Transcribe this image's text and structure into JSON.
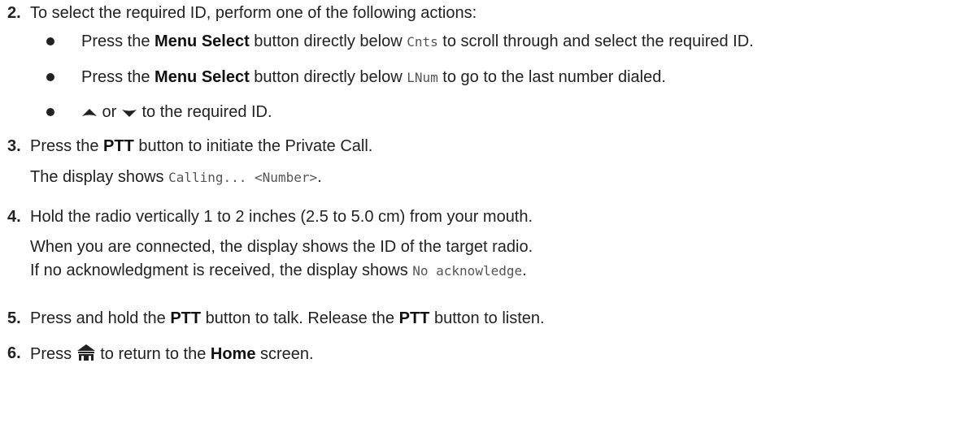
{
  "steps": [
    {
      "number": "2.",
      "text": "To select the required ID, perform one of the following actions:",
      "bullets": [
        {
          "pre": "Press the ",
          "bold": "Menu Select",
          "mid": " button directly below ",
          "code": "Cnts",
          "post": " to scroll through and select the required ID."
        },
        {
          "pre": "Press the ",
          "bold": "Menu Select",
          "mid": " button directly below ",
          "code": "LNum",
          "post": " to go to the last number dialed."
        },
        {
          "up_icon": "arrow-up-icon",
          "or": " or ",
          "down_icon": "arrow-down-icon",
          "post": " to the required ID."
        }
      ]
    },
    {
      "number": "3.",
      "pre": "Press the ",
      "bold": "PTT",
      "post": " button to initiate the Private Call.",
      "result_pre": "The display shows ",
      "result_code": "Calling... <Number>",
      "result_post": "."
    },
    {
      "number": "4.",
      "text": "Hold the radio vertically 1 to 2 inches (2.5 to 5.0 cm) from your mouth.",
      "result1": "When you are connected, the display shows the ID of the target radio.",
      "result2_pre": "If no acknowledgment is received, the display shows ",
      "result2_code": "No acknowledge",
      "result2_post": "."
    },
    {
      "number": "5.",
      "pre": "Press and hold the ",
      "bold1": "PTT",
      "mid": " button to talk. Release the ",
      "bold2": "PTT",
      "post": " button to listen."
    },
    {
      "number": "6.",
      "pre": "Press ",
      "icon": "home-icon",
      "mid": " to return to the ",
      "bold": "Home",
      "post": " screen."
    }
  ]
}
